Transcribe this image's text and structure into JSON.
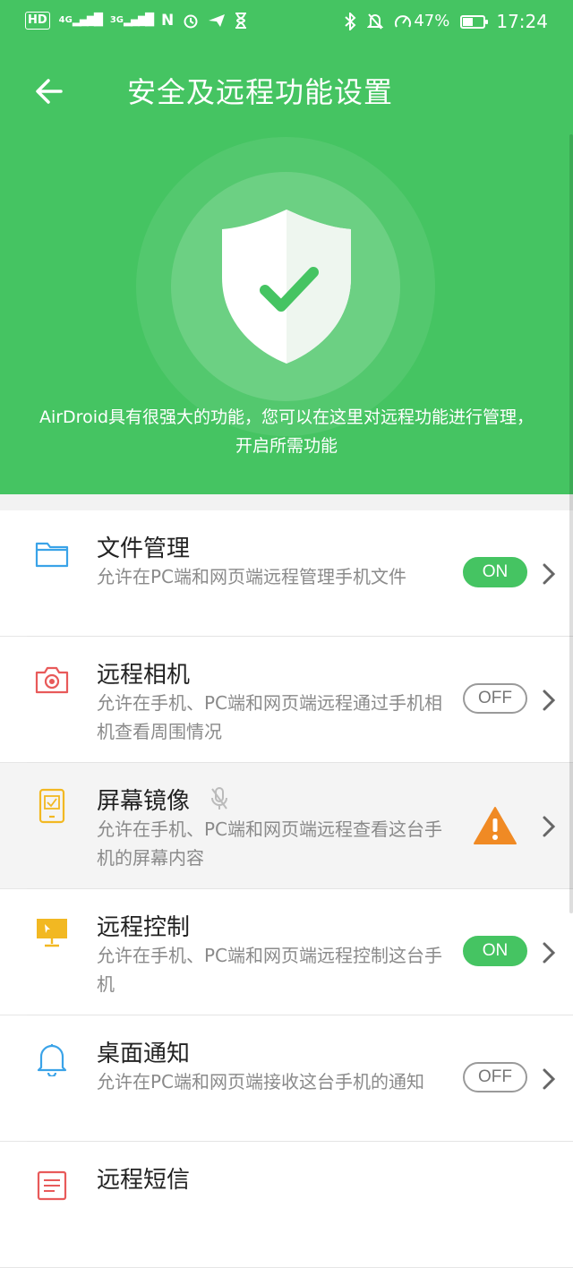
{
  "status_bar": {
    "left_chips": [
      "HD",
      "4G",
      "3G",
      "N"
    ],
    "battery_percent": "47%",
    "time": "17:24",
    "icons": [
      "hd-icon",
      "signal-4g-icon",
      "signal-3g-icon",
      "nfc-icon",
      "alarm-icon",
      "send-icon",
      "hourglass-icon",
      "bluetooth-icon",
      "mute-icon",
      "data-speed-icon",
      "battery-icon"
    ]
  },
  "header": {
    "title": "安全及远程功能设置",
    "back_icon": "arrow-left-icon"
  },
  "hero": {
    "icon": "shield-check-icon",
    "intro": "AirDroid具有很强大的功能，您可以在这里对远程功能进行管理，开启所需功能"
  },
  "items": [
    {
      "title": "文件管理",
      "desc": "允许在PC端和网页端远程管理手机文件",
      "state": "ON",
      "icon": "folder-icon",
      "color": "#3aa3e8"
    },
    {
      "title": "远程相机",
      "desc": "允许在手机、PC端和网页端远程通过手机相机查看周围情况",
      "state": "OFF",
      "icon": "camera-icon",
      "color": "#e85a5a"
    },
    {
      "title": "屏幕镜像",
      "desc": "允许在手机、PC端和网页端远程查看这台手机的屏幕内容",
      "state": "warning",
      "icon": "phone-screen-icon",
      "color": "#f2b822"
    },
    {
      "title": "远程控制",
      "desc": "允许在手机、PC端和网页端远程控制这台手机",
      "state": "ON",
      "icon": "monitor-cursor-icon",
      "color": "#f2b822"
    },
    {
      "title": "桌面通知",
      "desc": "允许在PC端和网页端接收这台手机的通知",
      "state": "OFF",
      "icon": "bell-icon",
      "color": "#3aa3e8"
    },
    {
      "title": "远程短信",
      "desc": "",
      "state": "",
      "icon": "message-icon",
      "color": "#e85a5a"
    }
  ],
  "colors": {
    "accent": "#45c462",
    "warning": "#f08a24"
  }
}
